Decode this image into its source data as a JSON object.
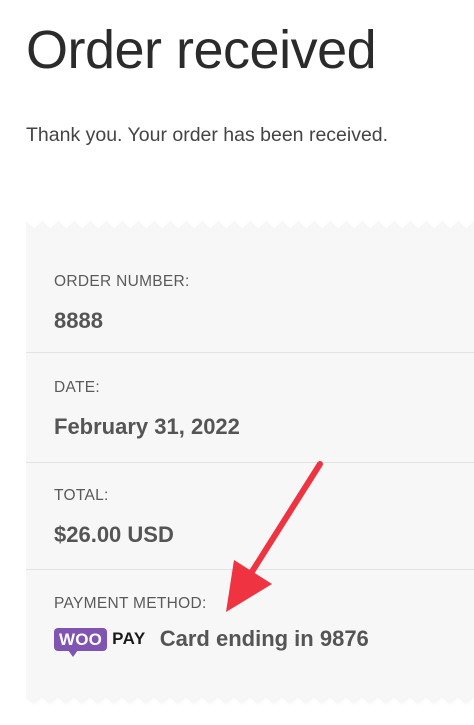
{
  "page": {
    "title": "Order received",
    "thank_you": "Thank you. Your order has been received."
  },
  "order": {
    "number_label": "ORDER NUMBER:",
    "number_value": "8888",
    "date_label": "DATE:",
    "date_value": "February 31, 2022",
    "total_label": "TOTAL:",
    "total_value": "$26.00 USD",
    "payment_label": "PAYMENT METHOD:",
    "payment_value": "Card ending in 9876",
    "woopay_logo": {
      "woo_text": "WOO",
      "pay_text": "PAY",
      "brand_color": "#7f54b3"
    }
  },
  "annotation": {
    "arrow_color": "#ef3340",
    "arrow_icon": "red-arrow-icon"
  },
  "colors": {
    "receipt_background": "#f7f7f7",
    "title_text": "#2b2b2b",
    "value_text": "#555555"
  }
}
